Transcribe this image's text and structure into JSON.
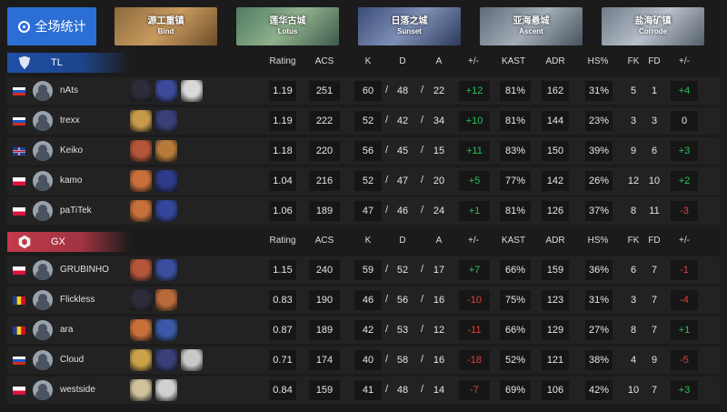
{
  "top": {
    "overall_label": "全场统计",
    "maps": [
      {
        "cn": "源工重镇",
        "en": "Bind",
        "bg": "linear-gradient(135deg,#8a6a3e,#c89a5d 50%,#6b4d2a)"
      },
      {
        "cn": "莲华古城",
        "en": "Lotus",
        "bg": "linear-gradient(135deg,#4f7a63,#8fb08c 50%,#3d5a4b)"
      },
      {
        "cn": "日落之城",
        "en": "Sunset",
        "bg": "linear-gradient(135deg,#3a4d78,#7e8fb5 50%,#2d3a5c)"
      },
      {
        "cn": "亚海悬城",
        "en": "Ascent",
        "bg": "linear-gradient(135deg,#5d6a78,#a3adb8 50%,#48525e)"
      },
      {
        "cn": "盐海矿镇",
        "en": "Corrode",
        "bg": "linear-gradient(135deg,#6f7a88,#b7c0ca 50%,#545e6a)"
      }
    ]
  },
  "columns": [
    "Rating",
    "ACS",
    "K",
    "D",
    "A",
    "+/-",
    "KAST",
    "ADR",
    "HS%",
    "FK",
    "FD",
    "+/-"
  ],
  "teams": [
    {
      "name": "TL",
      "color": "#1f4fa8",
      "players": [
        {
          "flag": "ru",
          "name": "nAts",
          "agents": [
            "#2c2c3a",
            "#3b4b9a",
            "#d9d9d9"
          ],
          "rating": "1.19",
          "acs": "251",
          "k": "60",
          "d": "48",
          "a": "22",
          "pm": "+12",
          "kast": "81%",
          "adr": "162",
          "hs": "31%",
          "fk": "5",
          "fd": "1",
          "fpm": "+4"
        },
        {
          "flag": "ru",
          "name": "trexx",
          "agents": [
            "#c79a4a",
            "#3a3f7a"
          ],
          "rating": "1.19",
          "acs": "222",
          "k": "52",
          "d": "42",
          "a": "34",
          "pm": "+10",
          "kast": "81%",
          "adr": "144",
          "hs": "23%",
          "fk": "3",
          "fd": "3",
          "fpm": "0"
        },
        {
          "flag": "gb",
          "name": "Keiko",
          "agents": [
            "#b5553a",
            "#b87a3a"
          ],
          "rating": "1.18",
          "acs": "220",
          "k": "56",
          "d": "45",
          "a": "15",
          "pm": "+11",
          "kast": "83%",
          "adr": "150",
          "hs": "39%",
          "fk": "9",
          "fd": "6",
          "fpm": "+3"
        },
        {
          "flag": "pl",
          "name": "kamo",
          "agents": [
            "#c7703a",
            "#2d3b88"
          ],
          "rating": "1.04",
          "acs": "216",
          "k": "52",
          "d": "47",
          "a": "20",
          "pm": "+5",
          "kast": "77%",
          "adr": "142",
          "hs": "26%",
          "fk": "12",
          "fd": "10",
          "fpm": "+2"
        },
        {
          "flag": "pl",
          "name": "paTiTek",
          "agents": [
            "#c7703a",
            "#34469a"
          ],
          "rating": "1.06",
          "acs": "189",
          "k": "47",
          "d": "46",
          "a": "24",
          "pm": "+1",
          "kast": "81%",
          "adr": "126",
          "hs": "37%",
          "fk": "8",
          "fd": "11",
          "fpm": "-3"
        }
      ]
    },
    {
      "name": "GX",
      "color": "#c23a4a",
      "players": [
        {
          "flag": "pl",
          "name": "GRUBINHO",
          "agents": [
            "#b5553a",
            "#3a4fa0"
          ],
          "rating": "1.15",
          "acs": "240",
          "k": "59",
          "d": "52",
          "a": "17",
          "pm": "+7",
          "kast": "66%",
          "adr": "159",
          "hs": "36%",
          "fk": "6",
          "fd": "7",
          "fpm": "-1"
        },
        {
          "flag": "ro",
          "name": "Flickless",
          "agents": [
            "#2c2c3a",
            "#b86a3a"
          ],
          "rating": "0.83",
          "acs": "190",
          "k": "46",
          "d": "56",
          "a": "16",
          "pm": "-10",
          "kast": "75%",
          "adr": "123",
          "hs": "31%",
          "fk": "3",
          "fd": "7",
          "fpm": "-4"
        },
        {
          "flag": "ro",
          "name": "ara",
          "agents": [
            "#c7703a",
            "#3a5aa8"
          ],
          "rating": "0.87",
          "acs": "189",
          "k": "42",
          "d": "53",
          "a": "12",
          "pm": "-11",
          "kast": "66%",
          "adr": "129",
          "hs": "27%",
          "fk": "8",
          "fd": "7",
          "fpm": "+1"
        },
        {
          "flag": "ru",
          "name": "Cloud",
          "agents": [
            "#c9a24a",
            "#3a3f7a",
            "#c8c8c8"
          ],
          "rating": "0.71",
          "acs": "174",
          "k": "40",
          "d": "58",
          "a": "16",
          "pm": "-18",
          "kast": "52%",
          "adr": "121",
          "hs": "38%",
          "fk": "4",
          "fd": "9",
          "fpm": "-5"
        },
        {
          "flag": "pl",
          "name": "westside",
          "agents": [
            "#cfc29a",
            "#d0d0d0"
          ],
          "rating": "0.84",
          "acs": "159",
          "k": "41",
          "d": "48",
          "a": "14",
          "pm": "-7",
          "kast": "69%",
          "adr": "106",
          "hs": "42%",
          "fk": "10",
          "fd": "7",
          "fpm": "+3"
        }
      ]
    }
  ]
}
